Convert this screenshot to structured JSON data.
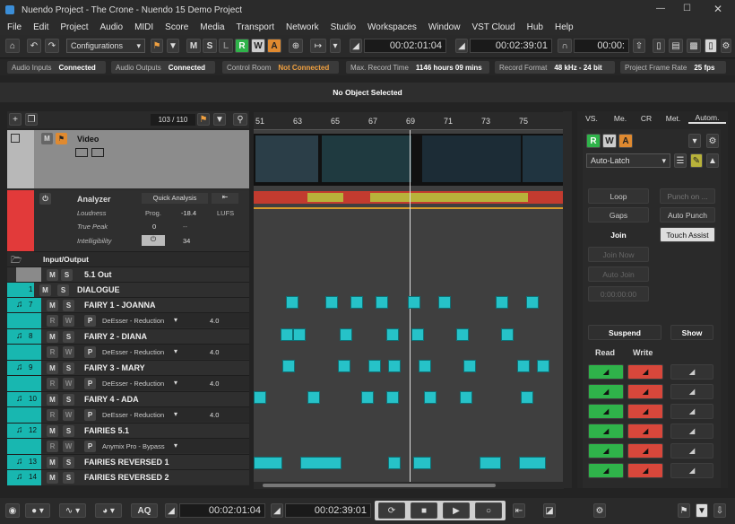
{
  "window": {
    "title": "Nuendo Project - The Crone - Nuendo 15 Demo Project"
  },
  "menu": [
    "File",
    "Edit",
    "Project",
    "Audio",
    "MIDI",
    "Score",
    "Media",
    "Transport",
    "Network",
    "Studio",
    "Workspaces",
    "Window",
    "VST Cloud",
    "Hub",
    "Help"
  ],
  "toolbar": {
    "mode": "Configurations",
    "m": "M",
    "s": "S",
    "l": "L",
    "r": "R",
    "w": "W",
    "a": "A",
    "time_left": "00:02:01:04",
    "time_right": "00:02:39:01",
    "time_third": "00:00:"
  },
  "status": [
    {
      "label": "Audio Inputs",
      "value": "Connected"
    },
    {
      "label": "Audio Outputs",
      "value": "Connected"
    },
    {
      "label": "Control Room",
      "value": "Not Connected"
    },
    {
      "label": "Max. Record Time",
      "value": "1146 hours 09 mins"
    },
    {
      "label": "Record Format",
      "value": "48 kHz - 24 bit"
    },
    {
      "label": "Project Frame Rate",
      "value": "25 fps"
    }
  ],
  "info": "No Object Selected",
  "track_count": "103 / 110",
  "ruler": [
    "51",
    "63",
    "65",
    "67",
    "69",
    "71",
    "73",
    "75"
  ],
  "tracks": {
    "video": "Video",
    "analyzer": {
      "name": "Analyzer",
      "mode": "Quick Analysis",
      "loudness": "Loudness",
      "prog": "Prog.",
      "value": "-18.4",
      "unit": "LUFS",
      "peak": "True Peak",
      "peak_value": "0",
      "peak_dash": "--",
      "intel": "Intelligibility",
      "intel_value": "34"
    },
    "io": "Input/Output",
    "out": "5.1 Out",
    "dialogue": {
      "num": "1",
      "name": "DIALOGUE"
    },
    "rows": [
      {
        "num": "7",
        "name": "FAIRY 1 - JOANNA",
        "insert": "DeEsser - Reduction",
        "value": "4.0"
      },
      {
        "num": "8",
        "name": "FAIRY 2 - DIANA",
        "insert": "DeEsser - Reduction",
        "value": "4.0"
      },
      {
        "num": "9",
        "name": "FAIRY 3 - MARY",
        "insert": "DeEsser - Reduction",
        "value": "4.0"
      },
      {
        "num": "10",
        "name": "FAIRY 4 - ADA",
        "insert": "DeEsser - Reduction",
        "value": "4.0"
      },
      {
        "num": "12",
        "name": "FAIRIES 5.1",
        "insert": "Anymix Pro - Bypass",
        "value": ""
      },
      {
        "num": "13",
        "name": "FAIRIES REVERSED 1",
        "insert": "",
        "value": ""
      },
      {
        "num": "14",
        "name": "FAIRIES REVERSED 2",
        "insert": "",
        "value": ""
      }
    ]
  },
  "inspector": {
    "tabs": [
      "VS.",
      "Me.",
      "CR",
      "Met.",
      "Autom."
    ],
    "auto_mode": "Auto-Latch",
    "buttons": {
      "loop": "Loop",
      "punch_on": "Punch on ...",
      "gaps": "Gaps",
      "auto_punch": "Auto Punch",
      "join": "Join",
      "touch_assist": "Touch Assist",
      "join_now": "Join Now",
      "auto_join": "Auto Join",
      "timecode": "0:00:00:00"
    },
    "suspend": "Suspend",
    "show": "Show",
    "read": "Read",
    "write": "Write"
  },
  "transport": {
    "aq": "AQ",
    "time1": "00:02:01:04",
    "time2": "00:02:39:01"
  }
}
